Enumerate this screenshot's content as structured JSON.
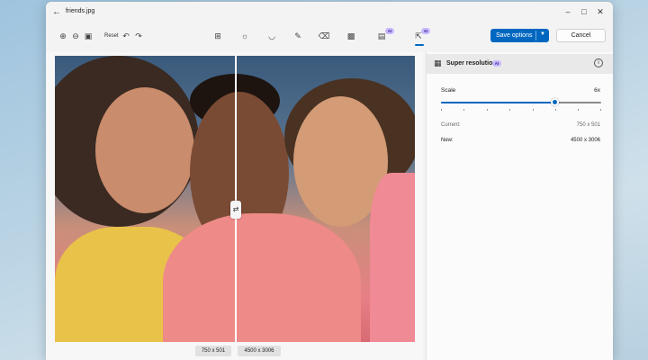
{
  "window": {
    "title": "friends.jpg"
  },
  "toolbar": {
    "reset_label": "Reset",
    "save_label": "Save options",
    "cancel_label": "Cancel",
    "ai_badge": "AI",
    "tools": [
      "crop-icon",
      "adjust-icon",
      "filter-icon",
      "markup-icon",
      "erase-icon",
      "blur-background-icon",
      "background-ai-icon",
      "super-resolution-icon"
    ]
  },
  "image": {
    "before_size": "750 x 501",
    "after_size": "4500 x 3006",
    "split_fraction": 0.5
  },
  "panel": {
    "title": "Super resolution",
    "ai_badge": "AI",
    "scale_label": "Scale",
    "scale_value": "6x",
    "scale_fraction": 0.71,
    "current_label": "Current:",
    "current_value": "750 x 501",
    "new_label": "New:",
    "new_value": "4500 x 3006"
  },
  "colors": {
    "accent": "#0067c0",
    "ai_badge": "#c8b8ff"
  }
}
